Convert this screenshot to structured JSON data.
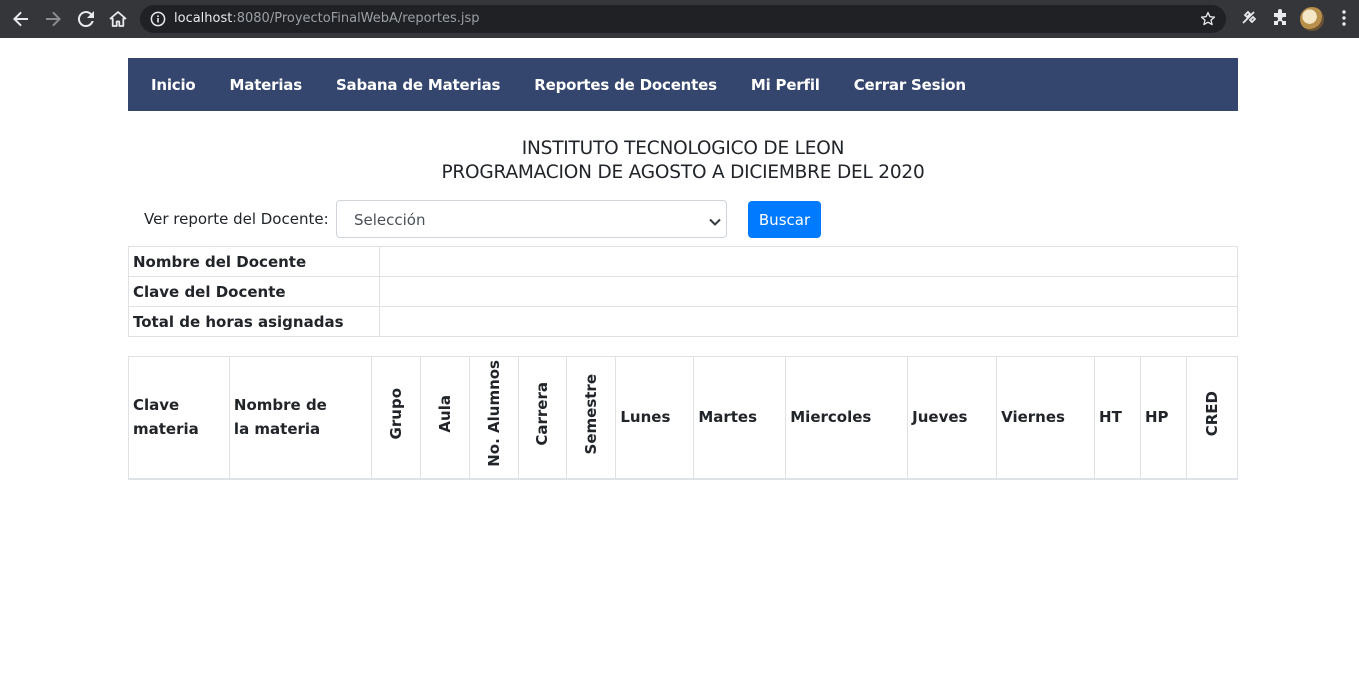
{
  "browser": {
    "url_host": "localhost",
    "url_rest": ":8080/ProyectoFinalWebA/reportes.jsp",
    "icons": [
      "back-icon",
      "forward-icon",
      "reload-icon",
      "home-icon",
      "info-icon",
      "star-icon",
      "extension-icon",
      "puzzle-icon",
      "avatar",
      "menu-icon"
    ]
  },
  "nav": {
    "items": [
      "Inicio",
      "Materias",
      "Sabana de Materias",
      "Reportes de Docentes",
      "Mi Perfil",
      "Cerrar Sesion"
    ]
  },
  "heading": {
    "line1": "INSTITUTO TECNOLOGICO DE LEON",
    "line2": "PROGRAMACION DE AGOSTO A DICIEMBRE DEL 2020"
  },
  "filter": {
    "label": "Ver reporte del Docente:",
    "selected": "Selección",
    "button": "Buscar"
  },
  "info_table": {
    "rows": [
      {
        "label": "Nombre del Docente",
        "value": ""
      },
      {
        "label": "Clave del Docente",
        "value": ""
      },
      {
        "label": "Total de horas asignadas",
        "value": ""
      }
    ]
  },
  "schedule_table": {
    "headers": {
      "clave_1": "Clave",
      "clave_2": "materia",
      "nombre_1": "Nombre de",
      "nombre_2": "la materia",
      "grupo": "Grupo",
      "aula": "Aula",
      "alumnos": "No. Alumnos",
      "carrera": "Carrera",
      "semestre": "Semestre",
      "lunes": "Lunes",
      "martes": "Martes",
      "miercoles": "Miercoles",
      "jueves": "Jueves",
      "viernes": "Viernes",
      "ht": "HT",
      "hp": "HP",
      "cred": "CRED"
    }
  },
  "colors": {
    "navbar": "#34456e",
    "primary_button": "#007bff",
    "chrome": "#35363a"
  }
}
